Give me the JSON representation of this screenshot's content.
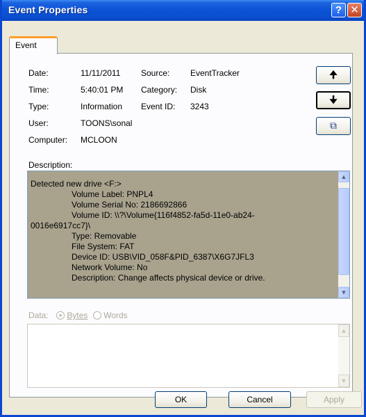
{
  "window": {
    "title": "Event Properties",
    "help_glyph": "?",
    "close_glyph": "✕"
  },
  "tabs": [
    {
      "label": "Event"
    }
  ],
  "fields": {
    "date_label": "Date:",
    "date_value": "11/11/2011",
    "source_label": "Source:",
    "source_value": "EventTracker",
    "time_label": "Time:",
    "time_value": "5:40:01 PM",
    "category_label": "Category:",
    "category_value": "Disk",
    "type_label": "Type:",
    "type_value": "Information",
    "eventid_label": "Event ID:",
    "eventid_value": "3243",
    "user_label": "User:",
    "user_value": "TOONS\\sonal",
    "computer_label": "Computer:",
    "computer_value": "MCLOON"
  },
  "nav_buttons": {
    "up_glyph": "🠉",
    "down_glyph": "🠋",
    "copy_glyph": "⧉"
  },
  "description": {
    "label": "Description:",
    "lines": [
      "Detected new drive <F:>",
      "Volume Label: PNPL4",
      "Volume Serial No: 2186692866",
      "Volume ID: \\\\?\\Volume{116f4852-fa5d-11e0-ab24-",
      "0016e6917cc7}\\",
      "Type: Removable",
      "File System: FAT",
      "Device ID: USB\\VID_058F&PID_6387\\X6G7JFL3",
      "Network Volume: No",
      "Description: Change affects physical device or drive."
    ]
  },
  "data_section": {
    "label": "Data:",
    "option_bytes": "Bytes",
    "option_words": "Words",
    "selected": "Bytes"
  },
  "footer": {
    "ok_label": "OK",
    "cancel_label": "Cancel",
    "apply_label": "Apply"
  },
  "colors": {
    "title_blue": "#0a4fd0",
    "desc_bg": "#a9a38e",
    "tab_accent": "#ff9d2b"
  }
}
